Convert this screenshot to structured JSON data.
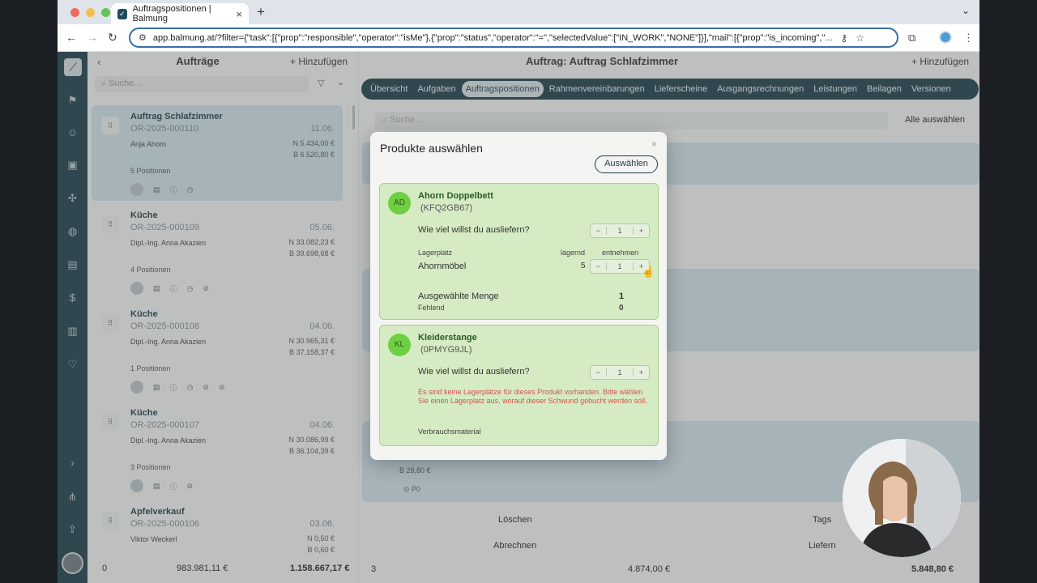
{
  "browser": {
    "tab_title": "Auftragspositionen | Balmung",
    "url": "app.balmung.at/?filter={\"task\":[{\"prop\":\"responsible\",\"operator\":\"isMe\"},{\"prop\":\"status\",\"operator\":\"=\",\"selectedValue\":[\"IN_WORK\",\"NONE\"]}],\"mail\":[{\"prop\":\"is_incoming\",\"..."
  },
  "list": {
    "title": "Aufträge",
    "add_label": "Hinzufügen",
    "search_placeholder": "Suche...",
    "orders": [
      {
        "name": "Auftrag Schlafzimmer",
        "number": "OR-2025-000110",
        "date": "11.06.",
        "customer": "Anja Ahorn",
        "n_value": "5.434,00 €",
        "b_value": "6.520,80 €",
        "positions": "5 Positionen"
      },
      {
        "name": "Küche",
        "number": "OR-2025-000109",
        "date": "05.06.",
        "customer": "Dipl.-Ing. Anna Akazien",
        "n_value": "33.082,23 €",
        "b_value": "39.698,68 €",
        "positions": "4 Positionen"
      },
      {
        "name": "Küche",
        "number": "OR-2025-000108",
        "date": "04.06.",
        "customer": "Dipl.-Ing. Anna Akazien",
        "n_value": "30.965,31 €",
        "b_value": "37.158,37 €",
        "positions": "1 Positionen"
      },
      {
        "name": "Küche",
        "number": "OR-2025-000107",
        "date": "04.06.",
        "customer": "Dipl.-Ing. Anna Akazien",
        "n_value": "30.086,99 €",
        "b_value": "36.104,39 €",
        "positions": "3 Positionen"
      },
      {
        "name": "Apfelverkauf",
        "number": "OR-2025-000106",
        "date": "03.06.",
        "customer": "Viktor Weckerl",
        "n_value": "0,50 €",
        "b_value": "0,60 €",
        "positions": ""
      }
    ],
    "footer": {
      "count": "0",
      "net": "983.981,11 €",
      "gross": "1.158.667,17 €"
    }
  },
  "detail": {
    "title": "Auftrag: Auftrag Schlafzimmer",
    "add_label": "Hinzufügen",
    "tabs": [
      "Übersicht",
      "Aufgaben",
      "Auftragspositionen",
      "Rahmenvereinbarungen",
      "Lieferscheine",
      "Ausgangsrechnungen",
      "Leistungen",
      "Beilagen",
      "Versionen"
    ],
    "search_placeholder": "Suche...",
    "select_all": "Alle auswählen",
    "ghost_value": "28,80 €",
    "ghost_small": "P0",
    "actions": {
      "delete": "Löschen",
      "tags": "Tags",
      "bill": "Abrechnen",
      "deliver": "Liefern"
    },
    "footer": {
      "count": "3",
      "net": "4.874,00 €",
      "gross": "5.848,80 €"
    }
  },
  "dialog": {
    "title": "Produkte auswählen",
    "choose_button": "Auswählen",
    "products": [
      {
        "initials": "AD",
        "name": "Ahorn Doppelbett",
        "code": "(KFQ2GB67)",
        "question": "Wie viel willst du ausliefern?",
        "qty": "1",
        "col_storage": "Lagerplatz",
        "col_stock": "lagernd",
        "col_take": "entnehmen",
        "storage_name": "Ahornmöbel",
        "storage_stock": "5",
        "storage_take": "1",
        "selected_label": "Ausgewählte Menge",
        "selected_value": "1",
        "missing_label": "Fehlend",
        "missing_value": "0"
      },
      {
        "initials": "KL",
        "name": "Kleiderstange",
        "code": "(0PMYG9JL)",
        "question": "Wie viel willst du ausliefern?",
        "qty": "1",
        "warning": "Es sind keine Lagerplätze für dieses Produkt vorhanden. Bitte wählen Sie einen Lagerplatz aus, worauf dieser Schwund gebucht werden soll.",
        "category": "Verbrauchsmaterial"
      }
    ]
  },
  "colors": {
    "accent": "#1d3b47",
    "product_bg": "#d4ebc3",
    "warning": "#d9534f"
  }
}
